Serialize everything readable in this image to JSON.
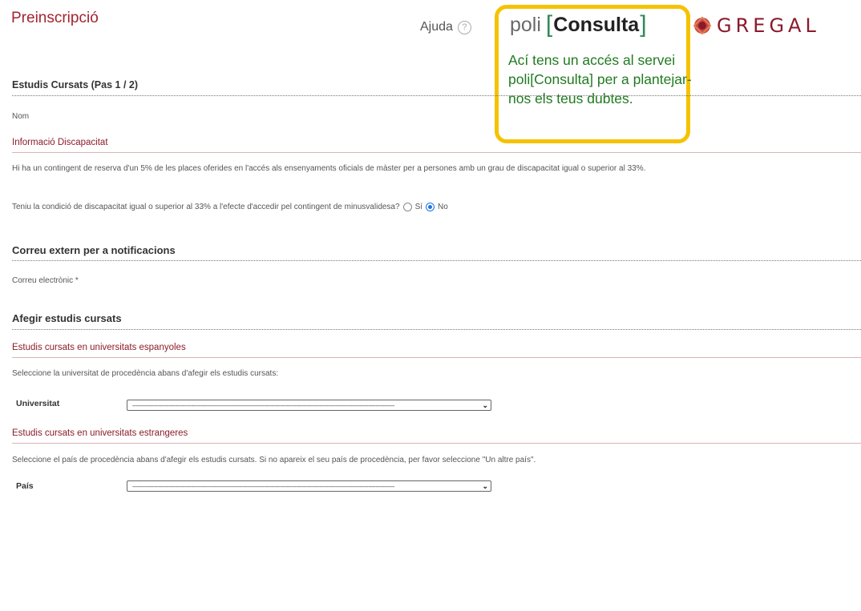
{
  "header": {
    "page_title": "Preinscripció",
    "help_label": "Ajuda",
    "help_icon": "question-circle-icon",
    "poli_prefix": "poli",
    "poli_bracket_open": "[",
    "poli_word": "Consulta",
    "poli_bracket_close": "]",
    "logo_text": "GREGAL"
  },
  "callout": {
    "text": "Ací tens un accés al servei poli[Consulta] per a plantejar-nos els teus dubtes.",
    "border_color": "#f5c200",
    "text_color": "#217a21"
  },
  "step": {
    "title": "Estudis Cursats (Pas 1 / 2)",
    "name_label": "Nom"
  },
  "disability": {
    "heading": "Informació Discapacitat",
    "info_text": "Hi ha un contingent de reserva d'un 5% de les places oferides en l'accés als ensenyaments oficials de màster per a persones amb un grau de discapacitat igual o superior al 33%.",
    "question": "Teniu la condició de discapacitat igual o superior al 33% a l'efecte d'accedir pel contingent de minusvalidesa?",
    "option_yes": "Sí",
    "option_no": "No",
    "selected": "No"
  },
  "notifications": {
    "heading": "Correu extern per a notificacions",
    "email_label": "Correu electrònic *"
  },
  "studies": {
    "heading": "Afegir estudis cursats",
    "spanish": {
      "heading": "Estudis cursats en universitats espanyoles",
      "instructions": "Seleccione la universitat de procedència abans d'afegir els estudis cursats:",
      "field_label": "Universitat",
      "select_value": "-------------------------------------------------------------------------------------------------------------------------------------------------------"
    },
    "foreign": {
      "heading": "Estudis cursats en universitats estrangeres",
      "instructions": "Seleccione el país de procedència abans d'afegir els estudis cursats. Si no apareix el seu país de procedència, per favor seleccione \"Un altre país\".",
      "field_label": "País",
      "select_value": "-------------------------------------------------------------------------------------------------------------------------------------------------------"
    }
  },
  "colors": {
    "title_red": "#a3242f",
    "subheading_red": "#8b1c2a",
    "radio_blue": "#1a73e8",
    "poli_green": "#2e8b57"
  }
}
